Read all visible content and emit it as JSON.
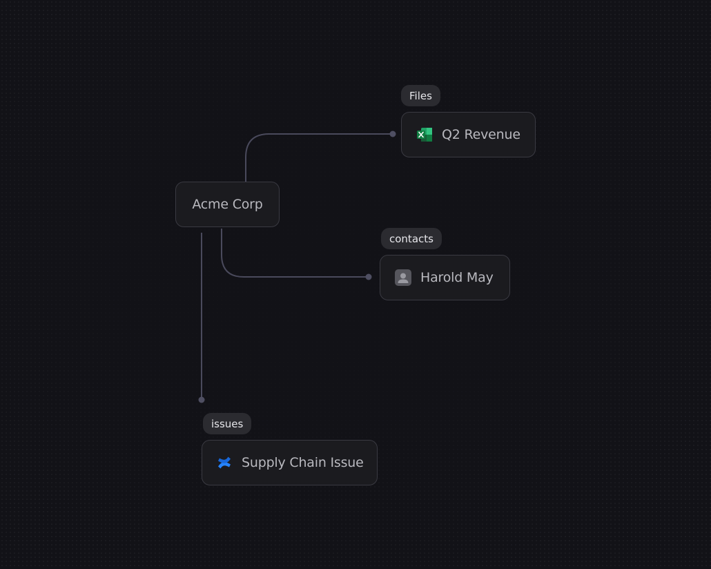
{
  "diagram": {
    "root": {
      "label": "Acme Corp"
    },
    "children": [
      {
        "category": "Files",
        "label": "Q2 Revenue",
        "icon": "excel-icon"
      },
      {
        "category": "contacts",
        "label": "Harold May",
        "icon": "contact-person-icon"
      },
      {
        "category": "issues",
        "label": "Supply Chain Issue",
        "icon": "confluence-icon"
      }
    ]
  },
  "colors": {
    "background": "#121217",
    "node_fill": "#1b1b1f",
    "node_border": "#3a3a42",
    "edge": "#4a4a5c",
    "tag_fill": "#2b2b30",
    "excel_green": "#1d6f42",
    "confluence_blue": "#2684ff"
  }
}
